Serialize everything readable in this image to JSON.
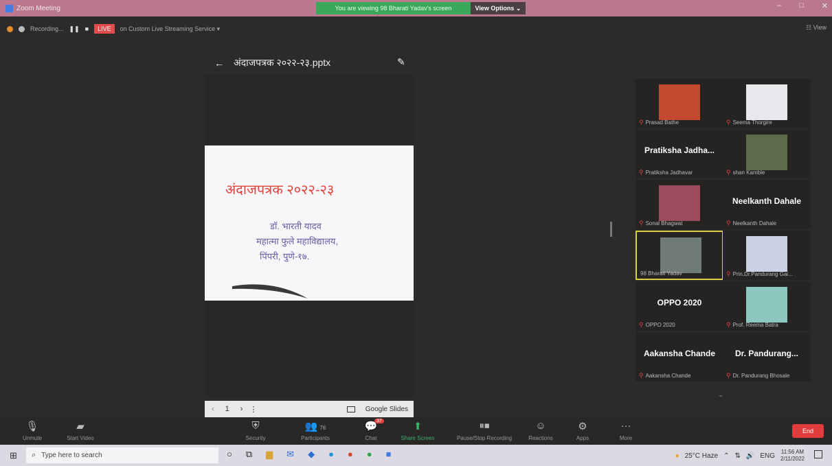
{
  "titlebar": {
    "app_title": "Zoom Meeting",
    "viewing_banner": "You are viewing 98 Bharati Yadav's screen",
    "view_options": "View Options ⌄",
    "minimize": "–",
    "maximize": "□",
    "close": "✕"
  },
  "recording": {
    "recording_label": "Recording...",
    "pause": "❚❚",
    "stop": "■",
    "live_badge": "LIVE",
    "live_service": "on Custom Live Streaming Service ▾",
    "view_label": "☷ View"
  },
  "share": {
    "back_arrow": "←",
    "filename": "अंदाजपत्रक २०२२-२३.pptx",
    "pencil": "✎",
    "slide": {
      "title": "अंदाजपत्रक २०२२-२३",
      "lines": [
        "डॉ. भारती यादव",
        "महात्मा फुले महाविद्यालय,",
        "पिंपरी, पुणे-१७."
      ]
    },
    "nav": {
      "prev": "‹",
      "page": "1",
      "next": "›",
      "more": "⋮",
      "google_slides": "Google Slides"
    }
  },
  "gallery": {
    "tiles": [
      {
        "name": "Prasad Bathe",
        "big": "",
        "photo": true,
        "color": "#c24a2e"
      },
      {
        "name": "Seema Thorgire",
        "big": "",
        "photo": true,
        "color": "#e9e7eb"
      },
      {
        "name": "Pratiksha Jadhavar",
        "big": "Pratiksha  Jadha...",
        "photo": false,
        "color": ""
      },
      {
        "name": "shan Kamble",
        "big": "",
        "photo": true,
        "color": "#5d6b4b"
      },
      {
        "name": "Sonal Bhagwat",
        "big": "",
        "photo": true,
        "color": "#9b4b5b"
      },
      {
        "name": "Neelkanth Dahale",
        "big": "Neelkanth Dahale",
        "photo": false,
        "color": ""
      },
      {
        "name": "98 Bharati Yadav",
        "big": "",
        "photo": true,
        "color": "#6f7b78"
      },
      {
        "name": "Prin.Dr.Pandurang Gai...",
        "big": "",
        "photo": true,
        "color": "#c8d2e4"
      },
      {
        "name": "OPPO 2020",
        "big": "OPPO 2020",
        "photo": false,
        "color": ""
      },
      {
        "name": "Prof. Reema Batra",
        "big": "",
        "photo": true,
        "color": "#8cc8bf"
      },
      {
        "name": "Aakansha Chande",
        "big": "Aakansha Chande",
        "photo": false,
        "color": ""
      },
      {
        "name": "Dr. Pandurang Bhosale",
        "big": "Dr.  Pandurang...",
        "photo": false,
        "color": ""
      }
    ],
    "scroll_down": "⌄"
  },
  "toolbar": {
    "unmute": "Unmute",
    "start_video": "Start Video",
    "security": "Security",
    "participants": "Participants",
    "participants_count": "76",
    "chat": "Chat",
    "chat_badge": "37",
    "share_screen": "Share Screen",
    "pause_recording": "Pause/Stop Recording",
    "reactions": "Reactions",
    "apps": "Apps",
    "more": "More",
    "end": "End"
  },
  "taskbar": {
    "search_placeholder": "Type here to search",
    "weather": "25°C  Haze",
    "lang": "ENG",
    "time": "11:56 AM",
    "date": "2/11/2022"
  }
}
